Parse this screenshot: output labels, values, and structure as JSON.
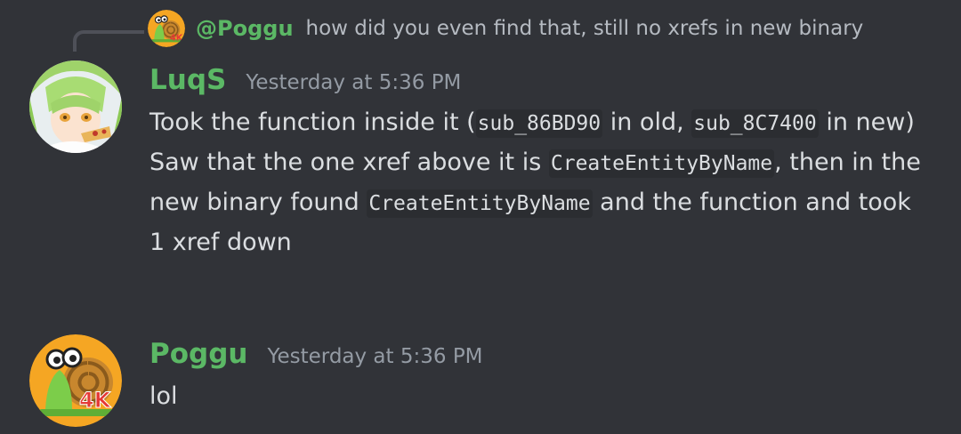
{
  "reply": {
    "author": "@Poggu",
    "text": "how did you even find that, still no xrefs in new binary"
  },
  "messages": [
    {
      "username": "LuqS",
      "timestamp": "Yesterday at 5:36 PM",
      "lines": {
        "p1_a": "Took the function inside it (",
        "p1_code1": "sub_86BD90",
        "p1_b": " in old, ",
        "p1_code2": "sub_8C7400",
        "p1_c": " in new)",
        "p2_a": "Saw that the one xref above it is ",
        "p2_code1": "CreateEntityByName",
        "p2_b": ", then in the new binary found ",
        "p2_code2": "CreateEntityByName",
        "p2_c": " and the function and took 1 xref down"
      }
    },
    {
      "username": "Poggu",
      "timestamp": "Yesterday at 5:36 PM",
      "text": "lol"
    }
  ],
  "avatars": {
    "poggu_badge": "4K",
    "colors": {
      "username_green": "#5bb865",
      "background": "#313338"
    }
  }
}
